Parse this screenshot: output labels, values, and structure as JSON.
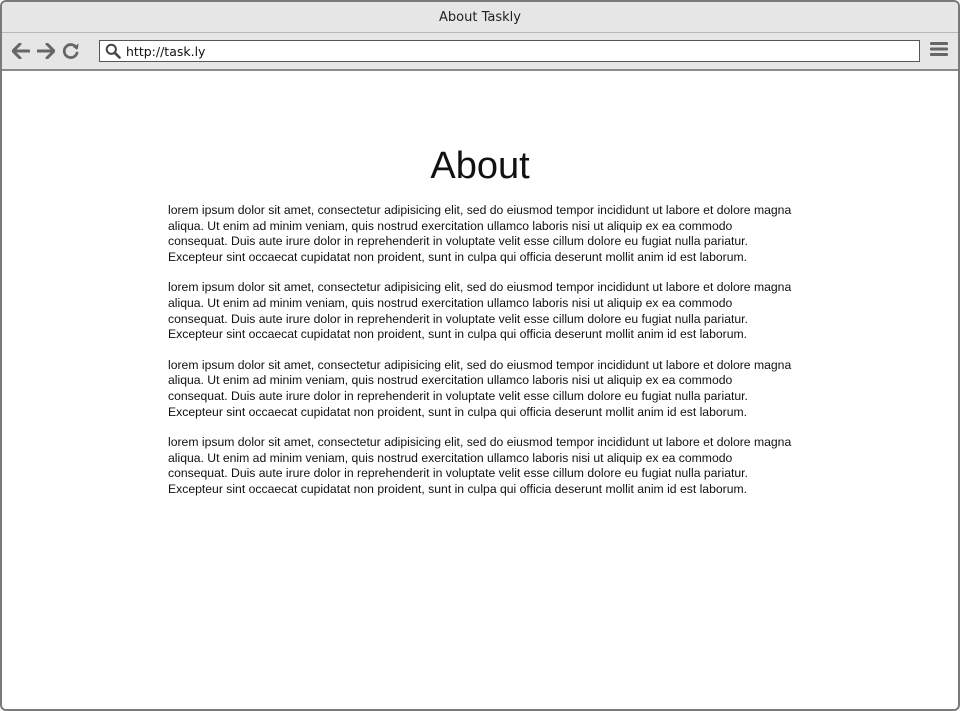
{
  "window": {
    "title": "About Taskly"
  },
  "toolbar": {
    "back_icon": "back-arrow-icon",
    "forward_icon": "forward-arrow-icon",
    "reload_icon": "reload-icon",
    "search_icon": "search-icon",
    "menu_icon": "hamburger-menu-icon",
    "url": "http://task.ly"
  },
  "page": {
    "heading": "About",
    "paragraphs": [
      "lorem ipsum dolor sit amet, consectetur adipisicing elit, sed do eiusmod tempor incididunt ut labore et dolore magna aliqua. Ut enim ad minim veniam, quis nostrud exercitation ullamco laboris nisi ut aliquip ex ea commodo consequat. Duis aute irure dolor in reprehenderit in voluptate velit esse cillum dolore eu fugiat nulla pariatur. Excepteur sint occaecat cupidatat non proident, sunt in culpa qui officia deserunt mollit anim id est laborum.",
      "lorem ipsum dolor sit amet, consectetur adipisicing elit, sed do eiusmod tempor incididunt ut labore et dolore magna aliqua. Ut enim ad minim veniam, quis nostrud exercitation ullamco laboris nisi ut aliquip ex ea commodo consequat. Duis aute irure dolor in reprehenderit in voluptate velit esse cillum dolore eu fugiat nulla pariatur. Excepteur sint occaecat cupidatat non proident, sunt in culpa qui officia deserunt mollit anim id est laborum.",
      "lorem ipsum dolor sit amet, consectetur adipisicing elit, sed do eiusmod tempor incididunt ut labore et dolore magna aliqua. Ut enim ad minim veniam, quis nostrud exercitation ullamco laboris nisi ut aliquip ex ea commodo consequat. Duis aute irure dolor in reprehenderit in voluptate velit esse cillum dolore eu fugiat nulla pariatur. Excepteur sint occaecat cupidatat non proident, sunt in culpa qui officia deserunt mollit anim id est laborum.",
      "lorem ipsum dolor sit amet, consectetur adipisicing elit, sed do eiusmod tempor incididunt ut labore et dolore magna aliqua. Ut enim ad minim veniam, quis nostrud exercitation ullamco laboris nisi ut aliquip ex ea commodo consequat. Duis aute irure dolor in reprehenderit in voluptate velit esse cillum dolore eu fugiat nulla pariatur. Excepteur sint occaecat cupidatat non proident, sunt in culpa qui officia deserunt mollit anim id est laborum."
    ]
  },
  "colors": {
    "chrome": "#e6e6e6",
    "border": "#7a7a7a",
    "icon": "#666666",
    "text": "#111111"
  }
}
